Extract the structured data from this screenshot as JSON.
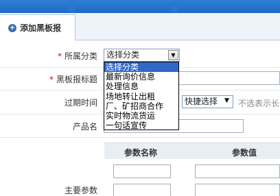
{
  "tab": {
    "icon": "plus-circle-icon",
    "label": "添加黑板报"
  },
  "form": {
    "category": {
      "label": "所属分类",
      "required_mark": "*",
      "value": "选择分类",
      "options": [
        "选择分类",
        "最新询价信息",
        "处理信息",
        "场地转让出租",
        "厂、矿招商合作",
        "实时物流货运",
        "一句话宣传"
      ],
      "selected_index": 0
    },
    "title": {
      "label": "黑板报标题",
      "required_mark": "*"
    },
    "expiry": {
      "label": "过期时间",
      "quick_select": "快捷选择",
      "hint": "不选表示长久"
    },
    "product": {
      "label": "产品名"
    },
    "params": {
      "label": "主要参数",
      "name_header": "参数名称",
      "value_header": "参数值"
    }
  },
  "colors": {
    "accent": "#1f6ac4",
    "selected": "#3169c6",
    "required": "#dd0000"
  }
}
